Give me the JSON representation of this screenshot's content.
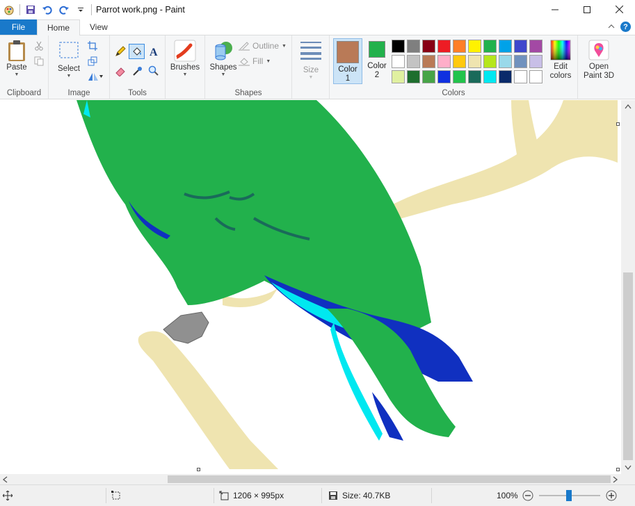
{
  "window": {
    "title": "Parrot work.png - Paint"
  },
  "tabs": {
    "file": "File",
    "home": "Home",
    "view": "View"
  },
  "ribbon": {
    "clipboard": {
      "paste": "Paste",
      "group": "Clipboard"
    },
    "image": {
      "select": "Select",
      "group": "Image"
    },
    "tools": {
      "group": "Tools"
    },
    "brushes": {
      "label": "Brushes"
    },
    "shapes": {
      "label": "Shapes",
      "outline": "Outline",
      "fill": "Fill",
      "group": "Shapes"
    },
    "size": {
      "label": "Size"
    },
    "colors": {
      "color1": "Color 1",
      "color1_num": "1",
      "color1_word": "Color",
      "color2_word": "Color",
      "color2_num": "2",
      "edit_top": "Edit",
      "edit_bottom": "colors",
      "group": "Colors",
      "color1_value": "#b97a57",
      "color2_value": "#22b14c",
      "palette": [
        "#000000",
        "#7f7f7f",
        "#880015",
        "#ed1c24",
        "#ff7f27",
        "#fff200",
        "#22b14c",
        "#00a2e8",
        "#3f48cc",
        "#a349a4",
        "#ffffff",
        "#c3c3c3",
        "#b97a57",
        "#ffaec9",
        "#ffc90e",
        "#efe4b0",
        "#b5e61d",
        "#99d9ea",
        "#7092be",
        "#c8bfe7",
        "#e0f0a0",
        "#1e6e2e",
        "#47a447",
        "#1030e0",
        "#22c34c",
        "#1a6a5a",
        "#00e8f0",
        "#0a2a6a",
        "#ffffff",
        "#ffffff"
      ]
    },
    "paint3d": {
      "top": "Open",
      "bottom": "Paint 3D"
    }
  },
  "status": {
    "dimensions": "1206 × 995px",
    "size": "Size: 40.7KB",
    "zoom": "100%"
  }
}
